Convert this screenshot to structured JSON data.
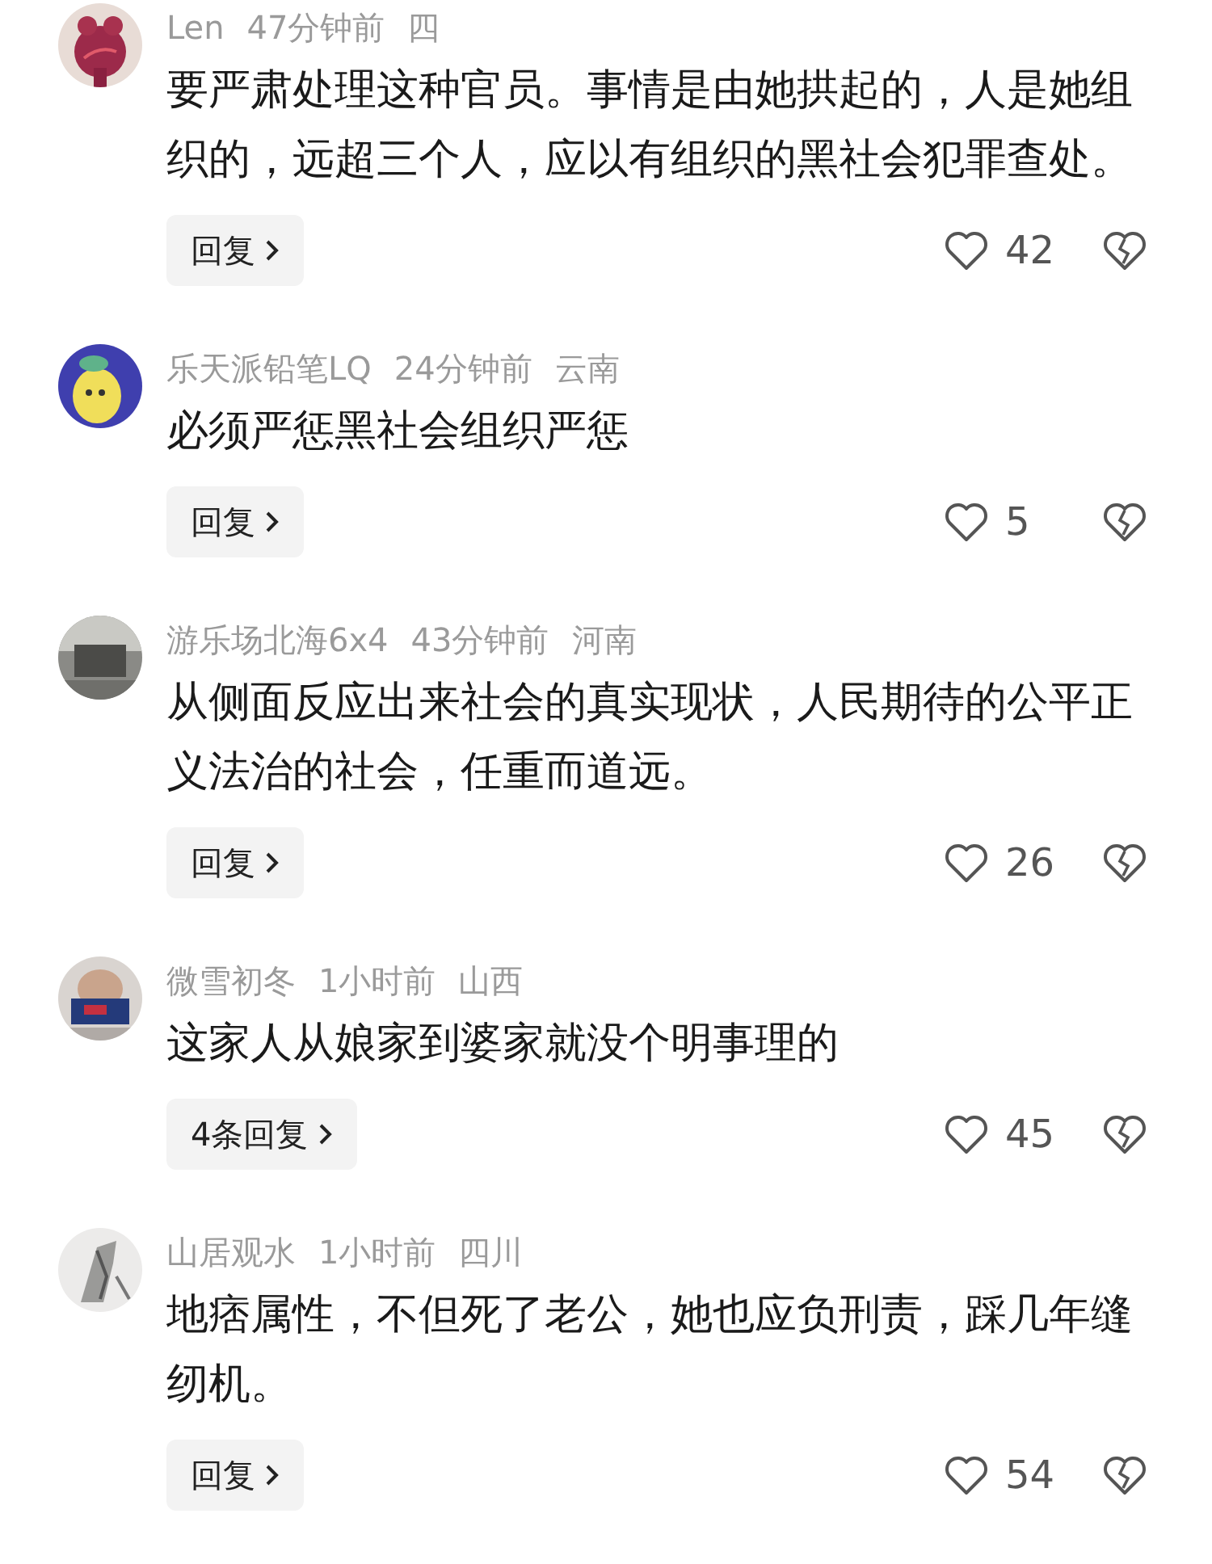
{
  "comments": [
    {
      "author": "Len",
      "time": "47分钟前",
      "location": "四",
      "text": "要严肃处理这种官员。事情是由她拱起的，人是她组织的，远超三个人，应以有组织的黑社会犯罪查处。",
      "replies": "回复",
      "likes": "42"
    },
    {
      "author": "乐天派铅笔LQ",
      "time": "24分钟前",
      "location": "云南",
      "text": "必须严惩黑社会组织严惩",
      "replies": "回复",
      "likes": "5"
    },
    {
      "author": "游乐场北海6x4",
      "time": "43分钟前",
      "location": "河南",
      "text": "从侧面反应出来社会的真实现状，人民期待的公平正义法治的社会，任重而道远。",
      "replies": "回复",
      "likes": "26"
    },
    {
      "author": "微雪初冬",
      "time": "1小时前",
      "location": "山西",
      "text": "这家人从娘家到婆家就没个明事理的",
      "replies": "4条回复",
      "likes": "45"
    },
    {
      "author": "山居观水",
      "time": "1小时前",
      "location": "四川",
      "text": "地痞属性，不但死了老公，她也应负刑责，踩几年缝纫机。",
      "replies": "回复",
      "likes": "54"
    }
  ]
}
